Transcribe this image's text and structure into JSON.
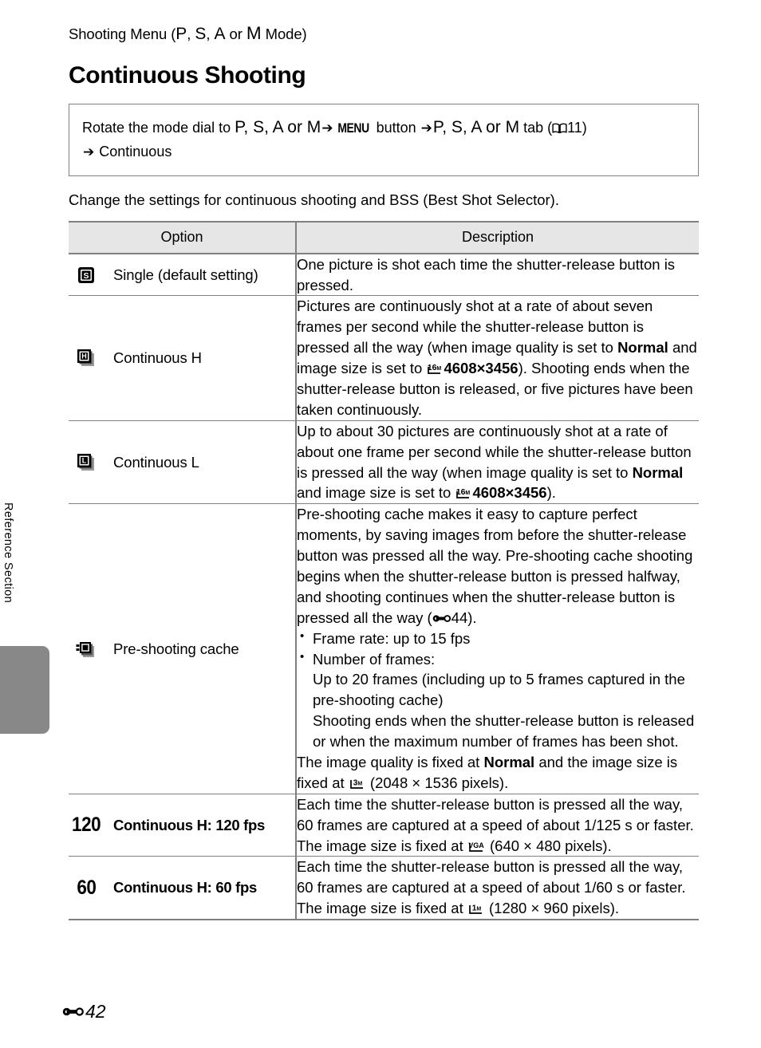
{
  "side_tab": {
    "label": "Reference Section"
  },
  "running_head": {
    "prefix": "Shooting Menu (",
    "modes": [
      "P",
      "S",
      "A",
      "M"
    ],
    "separator": ", ",
    "conjunction": " or ",
    "suffix": " Mode)"
  },
  "page_title": "Continuous Shooting",
  "howto": {
    "line1_a": "Rotate the mode dial to ",
    "line1_modes_1": "P, S, A or M",
    "arrow": "➔",
    "menu_button_label": "MENU",
    "button_word": " button ",
    "line1_modes_2": "P, S, A or M",
    "tab_word": " tab (",
    "book_ref": "11",
    "close_paren": ")",
    "line2": "Continuous"
  },
  "lead_text": "Change the settings for continuous shooting and BSS (Best Shot Selector).",
  "table": {
    "headers": {
      "option": "Option",
      "description": "Description"
    },
    "rows": [
      {
        "icon": "single-shot-icon",
        "icon_glyph": "S",
        "label": "Single (default setting)",
        "description_text": "One picture is shot each time the shutter-release button is pressed."
      },
      {
        "icon": "continuous-high-icon",
        "icon_glyph": "H",
        "label": "Continuous H",
        "desc_part1": "Pictures are continuously shot at a rate of about seven frames per second while the shutter-release button is pressed all the way (when image quality is set to ",
        "desc_bold1": "Normal",
        "desc_part2": " and image size is set to ",
        "desc_icon": "16m-image-size-icon",
        "desc_bold2": "4608×3456",
        "desc_part3": "). Shooting ends when the shutter-release button is released, or five pictures have been taken continuously."
      },
      {
        "icon": "continuous-low-icon",
        "icon_glyph": "L",
        "label": "Continuous L",
        "desc_part1": "Up to about 30 pictures are continuously shot at a rate of about one frame per second while the shutter-release button is pressed all the way (when image quality is set to ",
        "desc_bold1": "Normal",
        "desc_part2": " and image size is set to ",
        "desc_icon": "16m-image-size-icon",
        "desc_bold2": "4608×3456",
        "desc_part3": ")."
      },
      {
        "icon": "pre-shooting-cache-icon",
        "label": "Pre-shooting cache",
        "desc_para1_a": "Pre-shooting cache makes it easy to capture perfect moments, by saving images from before the shutter-release button was pressed all the way. Pre-shooting cache shooting begins when the shutter-release button is pressed halfway, and shooting continues when the shutter-release button is pressed all the way (",
        "desc_para1_ref": "44",
        "desc_para1_b": ").",
        "bullet1": "Frame rate: up to 15 fps",
        "bullet2": "Number of frames:",
        "sub1": "Up to 20 frames (including up to 5 frames captured in the pre-shooting cache)",
        "sub2": "Shooting ends when the shutter-release button is released or when the maximum number of frames has been shot.",
        "desc_para2_a": "The image quality is fixed at ",
        "desc_para2_bold": "Normal",
        "desc_para2_b": " and the image size is fixed at ",
        "desc_para2_icon": "3m-image-size-icon",
        "desc_para2_c": " (2048 × 1536 pixels)."
      },
      {
        "icon": "fps-number",
        "icon_number": "120",
        "label": "Continuous H: 120 fps",
        "desc_part1": "Each time the shutter-release button is pressed all the way, 60 frames are captured at a speed of about 1/125 s or faster. The image size is fixed at ",
        "desc_icon": "vga-image-size-icon",
        "desc_part2": " (640 × 480 pixels)."
      },
      {
        "icon": "fps-number",
        "icon_number": "60",
        "label": "Continuous H: 60 fps",
        "desc_part1": "Each time the shutter-release button is pressed all the way, 60 frames are captured at a speed of about 1/60 s or faster. The image size is fixed at ",
        "desc_icon": "1m-image-size-icon",
        "desc_part2": " (1280 × 960 pixels)."
      }
    ]
  },
  "footer": {
    "page_number": "42"
  },
  "colors": {
    "rule": "#808080",
    "header_fill": "#e6e6e6",
    "tab_gray": "#888888"
  }
}
